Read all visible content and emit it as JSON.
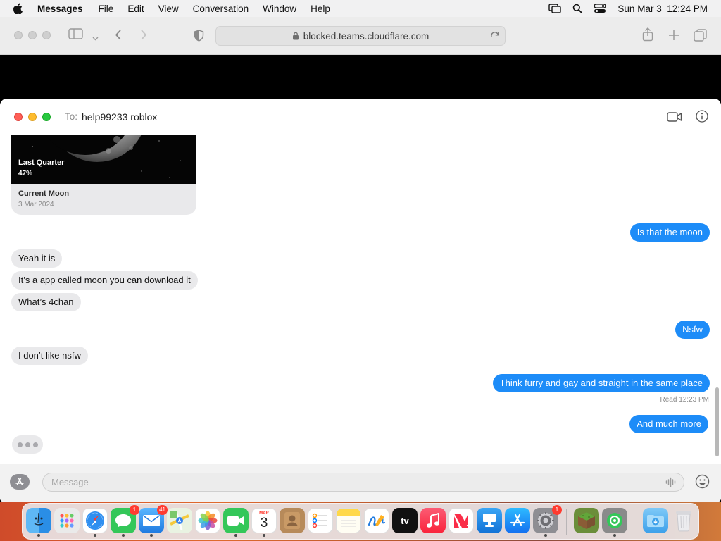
{
  "menubar": {
    "app_name": "Messages",
    "items": [
      "File",
      "Edit",
      "View",
      "Conversation",
      "Window",
      "Help"
    ],
    "datetime": "Sun Mar 3  12:24 PM"
  },
  "safari": {
    "url": "blocked.teams.cloudflare.com"
  },
  "conversation": {
    "to_label": "To:",
    "recipient": "help99233 roblox",
    "card": {
      "phase": "Last Quarter",
      "percent": "47%",
      "title": "Current Moon",
      "date": "3 Mar 2024"
    },
    "messages": [
      {
        "side": "out",
        "text": "Is that the moon"
      },
      {
        "side": "in",
        "text": "Yeah it is"
      },
      {
        "side": "in",
        "text": "It’s a app called moon you can download it"
      },
      {
        "side": "in",
        "text": "What’s 4chan"
      },
      {
        "side": "out",
        "text": "Nsfw"
      },
      {
        "side": "in",
        "text": "I don’t like nsfw"
      },
      {
        "side": "out",
        "text": "Think furry and gay and straight in the same place"
      },
      {
        "side": "out",
        "text": "And much more"
      }
    ],
    "read_receipt_label": "Read",
    "read_receipt_time": "12:23 PM"
  },
  "composer": {
    "placeholder": "Message"
  },
  "dock": {
    "messages_badge": "1",
    "mail_badge": "41",
    "calendar_month": "MAR",
    "calendar_day": "3",
    "tv_label": "tv",
    "settings_badge": "1"
  },
  "colors": {
    "outgoing_bubble": "#1d8cf8",
    "incoming_bubble": "#e9e9eb"
  }
}
